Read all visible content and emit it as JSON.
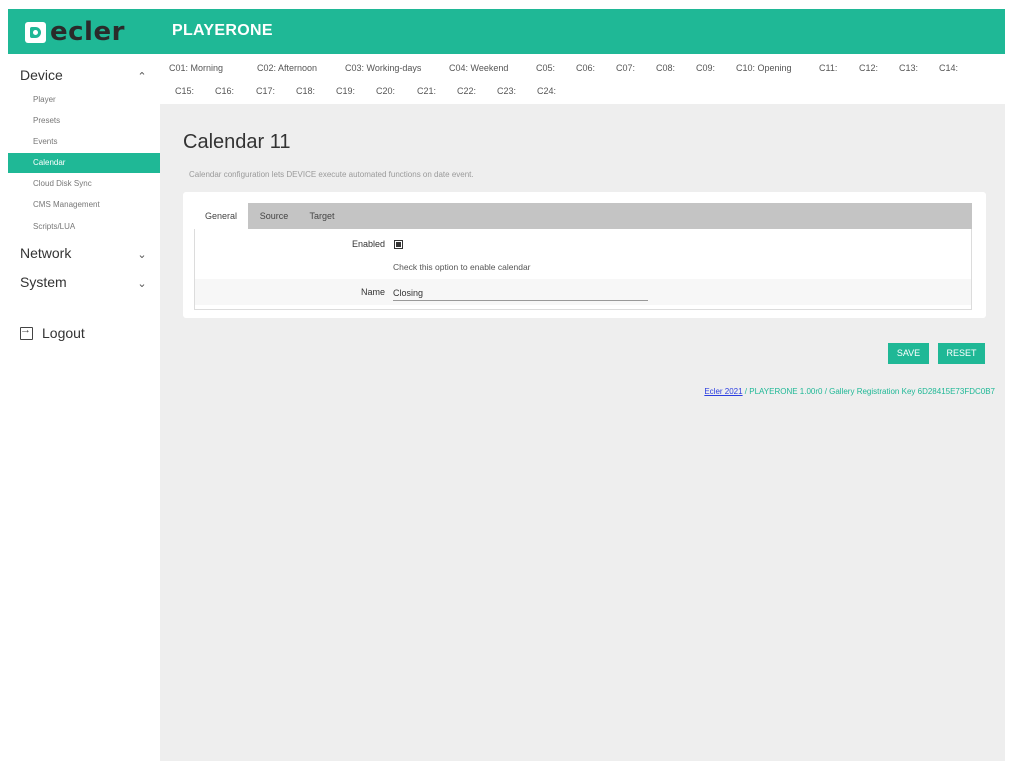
{
  "header": {
    "logo_text": "ecler",
    "app_title": "PLAYERONE",
    "brand_color": "#1fb896"
  },
  "sidebar": {
    "device": {
      "label": "Device",
      "icon": "chevron-up-icon"
    },
    "device_items": [
      {
        "label": "Player",
        "active": false
      },
      {
        "label": "Presets",
        "active": false
      },
      {
        "label": "Events",
        "active": false
      },
      {
        "label": "Calendar",
        "active": true
      },
      {
        "label": "Cloud Disk Sync",
        "active": false
      },
      {
        "label": "CMS Management",
        "active": false
      },
      {
        "label": "Scripts/LUA",
        "active": false
      }
    ],
    "network": {
      "label": "Network",
      "icon": "chevron-down-icon"
    },
    "system": {
      "label": "System",
      "icon": "chevron-down-icon"
    },
    "logout": {
      "label": "Logout",
      "icon": "logout-icon"
    }
  },
  "calendars": {
    "row1": [
      "C01: Morning",
      "C02: Afternoon",
      "C03: Working-days",
      "C04: Weekend",
      "C05:",
      "C06:",
      "C07:",
      "C08:",
      "C09:",
      "C10: Opening",
      "C11:",
      "C12:",
      "C13:",
      "C14:"
    ],
    "row2": [
      "C15:",
      "C16:",
      "C17:",
      "C18:",
      "C19:",
      "C20:",
      "C21:",
      "C22:",
      "C23:",
      "C24:"
    ]
  },
  "main": {
    "title": "Calendar 11",
    "description": "Calendar configuration lets DEVICE execute automated functions on date event.",
    "tabs": [
      "General",
      "Source",
      "Target"
    ],
    "active_tab": "General",
    "form": {
      "enabled_label": "Enabled",
      "enabled_checked": true,
      "enabled_help": "Check this option to enable calendar",
      "name_label": "Name",
      "name_value": "Closing"
    },
    "save_label": "SAVE",
    "reset_label": "RESET"
  },
  "footer": {
    "link_text": "Ecler 2021",
    "text": " / PLAYERONE 1.00r0 / Gallery Registration Key 6D28415E73FDC0B7"
  }
}
